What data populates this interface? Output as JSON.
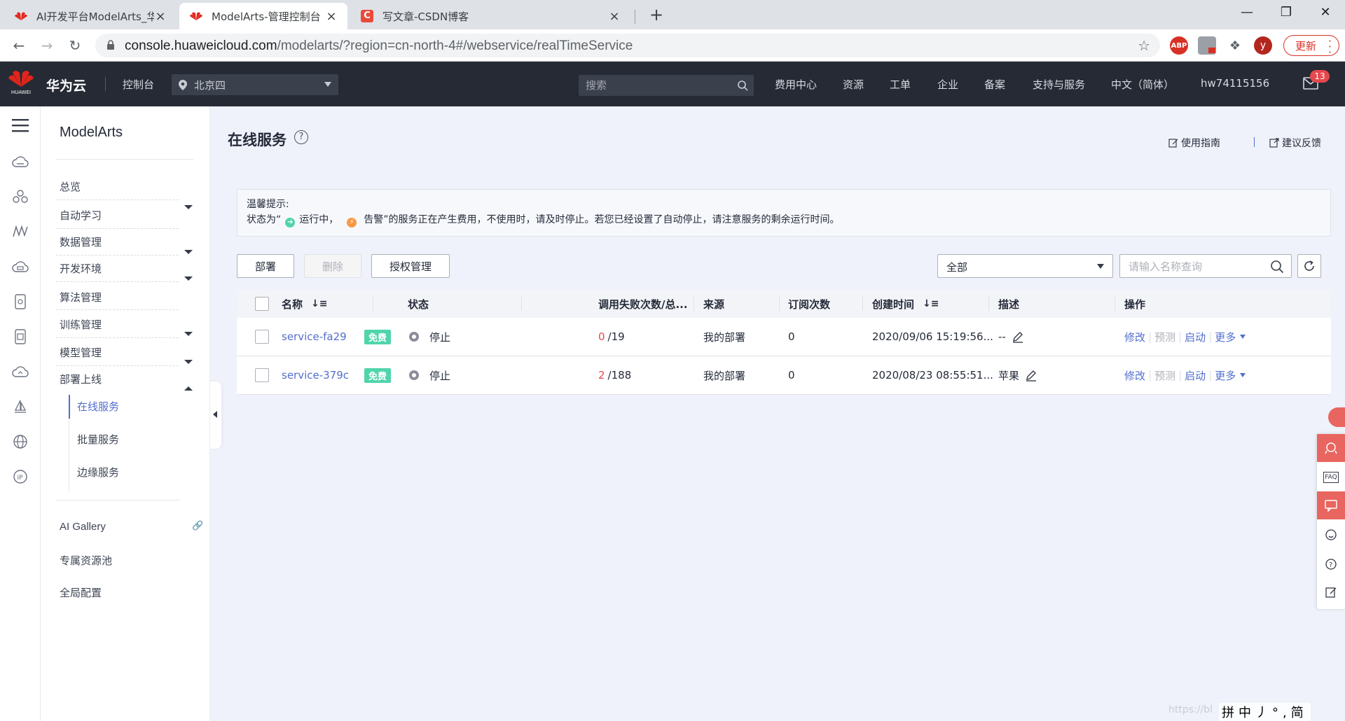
{
  "browser": {
    "tabs": [
      {
        "title": "AI开发平台ModelArts_华为云",
        "active": false
      },
      {
        "title": "ModelArts-管理控制台",
        "active": true
      },
      {
        "title": "写文章-CSDN博客",
        "active": false
      }
    ],
    "url_host": "console.huaweicloud.com",
    "url_path": "/modelarts/?region=cn-north-4#/webservice/realTimeService",
    "update_label": "更新",
    "profile_initial": "y"
  },
  "header": {
    "logo_caption": "HUAWEI",
    "brand": "华为云",
    "console": "控制台",
    "region": "北京四",
    "search_placeholder": "搜索",
    "nav": [
      "费用中心",
      "资源",
      "工单",
      "企业",
      "备案",
      "支持与服务",
      "中文（简体）",
      "hw74115156"
    ],
    "mail_count": "13"
  },
  "sidenav": {
    "title": "ModelArts",
    "items": [
      {
        "label": "总览"
      },
      {
        "label": "自动学习"
      },
      {
        "label": "数据管理"
      },
      {
        "label": "开发环境"
      },
      {
        "label": "算法管理"
      },
      {
        "label": "训练管理"
      },
      {
        "label": "模型管理"
      },
      {
        "label": "部署上线"
      }
    ],
    "sub_items": [
      {
        "label": "在线服务",
        "active": true
      },
      {
        "label": "批量服务",
        "active": false
      },
      {
        "label": "边缘服务",
        "active": false
      }
    ],
    "bottom_items": [
      {
        "label": "AI Gallery"
      },
      {
        "label": "专属资源池"
      },
      {
        "label": "全局配置"
      }
    ]
  },
  "page": {
    "title": "在线服务",
    "guide_link": "使用指南",
    "feedback_link": "建议反馈",
    "notice_title": "温馨提示:",
    "notice_prefix": "状态为“",
    "notice_running": "运行中，",
    "notice_warning": "告警",
    "notice_suffix": "”的服务正在产生费用，不使用时，请及时停止。若您已经设置了自动停止，请注意服务的剩余运行时间。"
  },
  "toolbar": {
    "deploy": "部署",
    "delete": "删除",
    "authorize": "授权管理",
    "filter_value": "全部",
    "name_search_placeholder": "请输入名称查询"
  },
  "table": {
    "headers": [
      "名称",
      "状态",
      "调用失败次数/总...",
      "来源",
      "订阅次数",
      "创建时间",
      "描述",
      "操作"
    ],
    "rows": [
      {
        "name": "service-fa29",
        "badge": "免费",
        "status": "停止",
        "fail": "0",
        "total": "/19",
        "source": "我的部署",
        "subs": "0",
        "created": "2020/09/06 15:19:56...",
        "desc": "--"
      },
      {
        "name": "service-379c",
        "badge": "免费",
        "status": "停止",
        "fail": "2",
        "total": "/188",
        "source": "我的部署",
        "subs": "0",
        "created": "2020/08/23 08:55:51...",
        "desc": "苹果"
      }
    ],
    "ops": {
      "edit": "修改",
      "predict": "预测",
      "start": "启动",
      "more": "更多"
    }
  },
  "ime": "拼中丿°,简",
  "watermark": "https://bl",
  "colors": {
    "brand_red": "#e1251b",
    "link": "#526ecc",
    "free_badge": "#50d4ab",
    "fail": "#e5484d"
  }
}
